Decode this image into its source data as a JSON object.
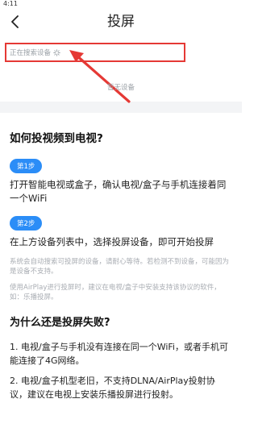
{
  "status_bar": {
    "time": "4:11"
  },
  "nav": {
    "title": "投屏"
  },
  "devices": {
    "searching_label": "正在搜索设备",
    "empty_label": "暂无设备"
  },
  "help": {
    "title": "如何投视频到电视?",
    "steps": [
      {
        "badge": "第1步",
        "text": "打开智能电视或盒子，确认电视/盒子与手机连接着同一个WiFi"
      },
      {
        "badge": "第2步",
        "text": "在上方设备列表中，选择投屏设备，即可开始投屏"
      }
    ],
    "notes": [
      "系统会自动搜索可投屏的设备，请耐心等待。若检测不到设备，可能因为是设备不支持。",
      "使用AirPlay进行投屏时，建议在电视/盒子中安装支持该协议的软件，如：乐播投屏。"
    ]
  },
  "failure": {
    "title": "为什么还是投屏失败?",
    "items": [
      "1. 电视/盒子与手机没有连接在同一个WiFi，或者手机可能连接了4G网络。",
      "2. 电视/盒子机型老旧，不支持DLNA/AirPlay投射协议，建议在电视上安装乐播投屏进行投射。"
    ]
  },
  "colors": {
    "accent": "#2b8df7",
    "highlight": "#e53935",
    "muted_text": "#9aa0a6"
  },
  "icons": {
    "back": "chevron-left-icon",
    "spinner": "loading-spinner-icon",
    "arrow": "red-arrow-annotation"
  }
}
